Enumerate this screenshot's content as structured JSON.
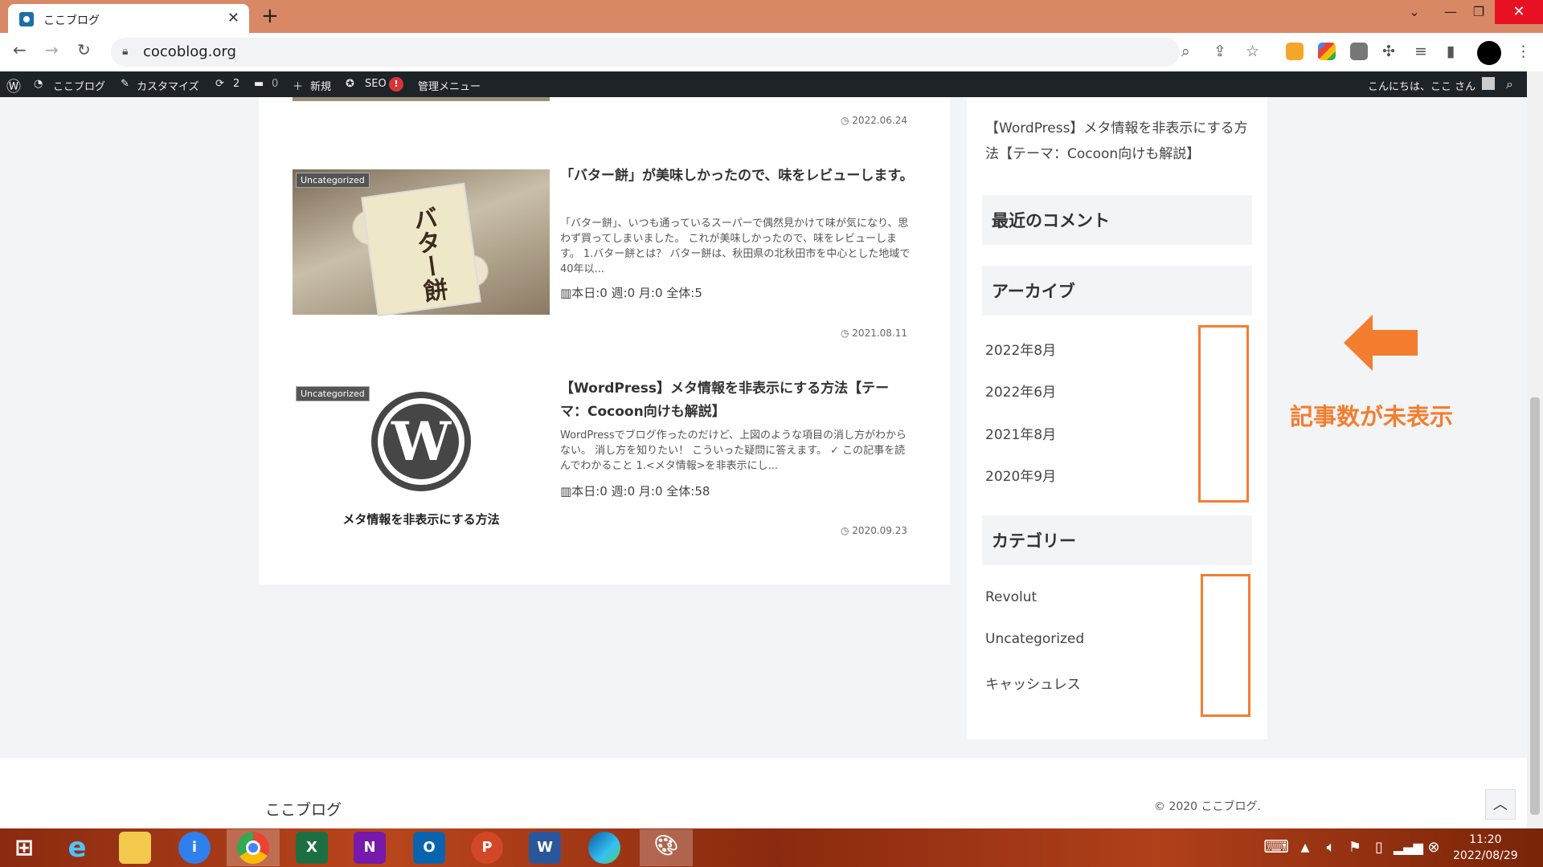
{
  "browser": {
    "tab_title": "ここブログ",
    "url": "cocoblog.org"
  },
  "wpbar": {
    "site": "ここブログ",
    "customize": "カスタマイズ",
    "updates": "2",
    "comments": "0",
    "new": "新規",
    "seo": "SEO",
    "seo_badge": "!",
    "admin_menu": "管理メニュー",
    "greeting": "こんにちは、ここ さん"
  },
  "posts": [
    {
      "date": "2022.06.24"
    },
    {
      "category": "Uncategorized",
      "title": "「バター餅」が美味しかったので、味をレビューします。",
      "excerpt": "「バター餅」、いつも通っているスーパーで偶然見かけて味が気になり、思わず買ってしまいました。 これが美味しかったので、味をレビューします。 1.バター餅とは？ バター餅は、秋田県の北秋田市を中心とした地域で40年以...",
      "stats": "本日:0 週:0 月:0 全体:5",
      "date": "2021.08.11",
      "thumb_label": "バター餅"
    },
    {
      "category": "Uncategorized",
      "title": "【WordPress】メタ情報を非表示にする方法【テーマ：Cocoon向けも解説】",
      "excerpt": "WordPressでブログ作ったのだけど、上図のような項目の消し方がわからない。 消し方を知りたい！ こういった疑問に答えます。 ✓ この記事を読んでわかること 1.<メタ情報>を非表示にし...",
      "stats": "本日:0 週:0 月:0 全体:58",
      "date": "2020.09.23",
      "thumb_caption": "メタ情報を非表示にする方法"
    }
  ],
  "sidebar": {
    "recent_post": "【WordPress】メタ情報を非表示にする方法【テーマ：Cocoon向けも解説】",
    "recent_comments_title": "最近のコメント",
    "archive_title": "アーカイブ",
    "archives": [
      "2022年8月",
      "2022年6月",
      "2021年8月",
      "2020年9月"
    ],
    "category_title": "カテゴリー",
    "categories": [
      "Revolut",
      "Uncategorized",
      "キャッシュレス"
    ]
  },
  "annotation": {
    "text": "記事数が未表示",
    "color": "#f47d30"
  },
  "footer": {
    "site": "ここブログ",
    "copyright": "© 2020 ここブログ."
  },
  "taskbar": {
    "time": "11:20",
    "date": "2022/08/29"
  }
}
